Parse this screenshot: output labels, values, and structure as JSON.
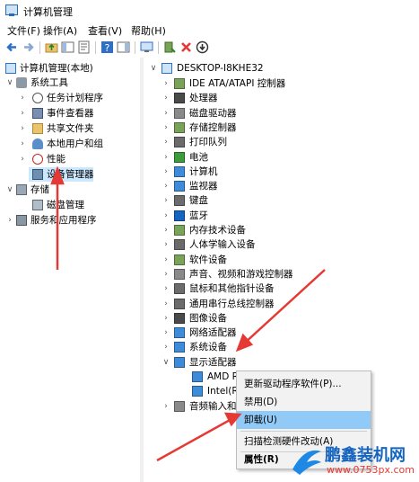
{
  "window": {
    "title": "计算机管理"
  },
  "menu": [
    {
      "label": "文件(F)"
    },
    {
      "label": "操作(A)"
    },
    {
      "label": "查看(V)"
    },
    {
      "label": "帮助(H)"
    }
  ],
  "left_tree": [
    {
      "label": "计算机管理(本地)",
      "icon": "computer-mgmt-icon",
      "arrow": ""
    },
    {
      "label": "系统工具",
      "icon": "tools-icon",
      "arrow": "v"
    },
    {
      "label": "任务计划程序",
      "icon": "clock-icon",
      "arrow": ">"
    },
    {
      "label": "事件查看器",
      "icon": "event-viewer-icon",
      "arrow": ">"
    },
    {
      "label": "共享文件夹",
      "icon": "folder-icon",
      "arrow": ">"
    },
    {
      "label": "本地用户和组",
      "icon": "users-icon",
      "arrow": ">"
    },
    {
      "label": "性能",
      "icon": "performance-icon",
      "arrow": ">"
    },
    {
      "label": "设备管理器",
      "icon": "device-manager-icon",
      "arrow": "",
      "selected": true
    },
    {
      "label": "存储",
      "icon": "storage-icon",
      "arrow": "v"
    },
    {
      "label": "磁盘管理",
      "icon": "disk-icon",
      "arrow": ""
    },
    {
      "label": "服务和应用程序",
      "icon": "services-icon",
      "arrow": ">"
    }
  ],
  "device_tree": {
    "root": "DESKTOP-I8KHE32",
    "items": [
      {
        "label": "IDE ATA/ATAPI 控制器",
        "icon": "ide-icon",
        "arrow": ">"
      },
      {
        "label": "处理器",
        "icon": "cpu-icon",
        "arrow": ">"
      },
      {
        "label": "磁盘驱动器",
        "icon": "disk-drive-icon",
        "arrow": ">"
      },
      {
        "label": "存储控制器",
        "icon": "storage-controller-icon",
        "arrow": ">"
      },
      {
        "label": "打印队列",
        "icon": "printer-icon",
        "arrow": ">"
      },
      {
        "label": "电池",
        "icon": "battery-icon",
        "arrow": ">"
      },
      {
        "label": "计算机",
        "icon": "monitor-icon",
        "arrow": ">"
      },
      {
        "label": "监视器",
        "icon": "monitor-icon",
        "arrow": ">"
      },
      {
        "label": "键盘",
        "icon": "keyboard-icon",
        "arrow": ">"
      },
      {
        "label": "蓝牙",
        "icon": "bluetooth-icon",
        "arrow": ">"
      },
      {
        "label": "内存技术设备",
        "icon": "memory-icon",
        "arrow": ">"
      },
      {
        "label": "人体学输入设备",
        "icon": "hid-icon",
        "arrow": ">"
      },
      {
        "label": "软件设备",
        "icon": "software-device-icon",
        "arrow": ">"
      },
      {
        "label": "声音、视频和游戏控制器",
        "icon": "sound-icon",
        "arrow": ">"
      },
      {
        "label": "鼠标和其他指针设备",
        "icon": "mouse-icon",
        "arrow": ">"
      },
      {
        "label": "通用串行总线控制器",
        "icon": "usb-icon",
        "arrow": ">"
      },
      {
        "label": "图像设备",
        "icon": "camera-icon",
        "arrow": ">"
      },
      {
        "label": "网络适配器",
        "icon": "network-icon",
        "arrow": ">"
      },
      {
        "label": "系统设备",
        "icon": "system-device-icon",
        "arrow": ">"
      },
      {
        "label": "显示适配器",
        "icon": "display-adapter-icon",
        "arrow": "v"
      },
      {
        "label": "AMD Radeon R5 M330",
        "icon": "monitor-icon",
        "arrow": "",
        "child": true
      },
      {
        "label": "Intel(R) HD Graphics",
        "icon": "monitor-icon",
        "arrow": "",
        "child": true
      },
      {
        "label": "音频输入和输出",
        "icon": "audio-icon",
        "arrow": ">"
      }
    ]
  },
  "context_menu": [
    {
      "label": "更新驱动程序软件(P)..."
    },
    {
      "label": "禁用(D)"
    },
    {
      "label": "卸载(U)",
      "highlighted": true
    },
    {
      "label": "扫描检测硬件改动(A)"
    },
    {
      "label": "属性(R)",
      "bold": true
    }
  ],
  "watermark": {
    "brand": "鹏鑫装机网",
    "url": "www.0753px.com"
  },
  "colors": {
    "arrow_red": "#e53935",
    "selection": "#cce8ff",
    "menu_highlight": "#91c9f7"
  }
}
